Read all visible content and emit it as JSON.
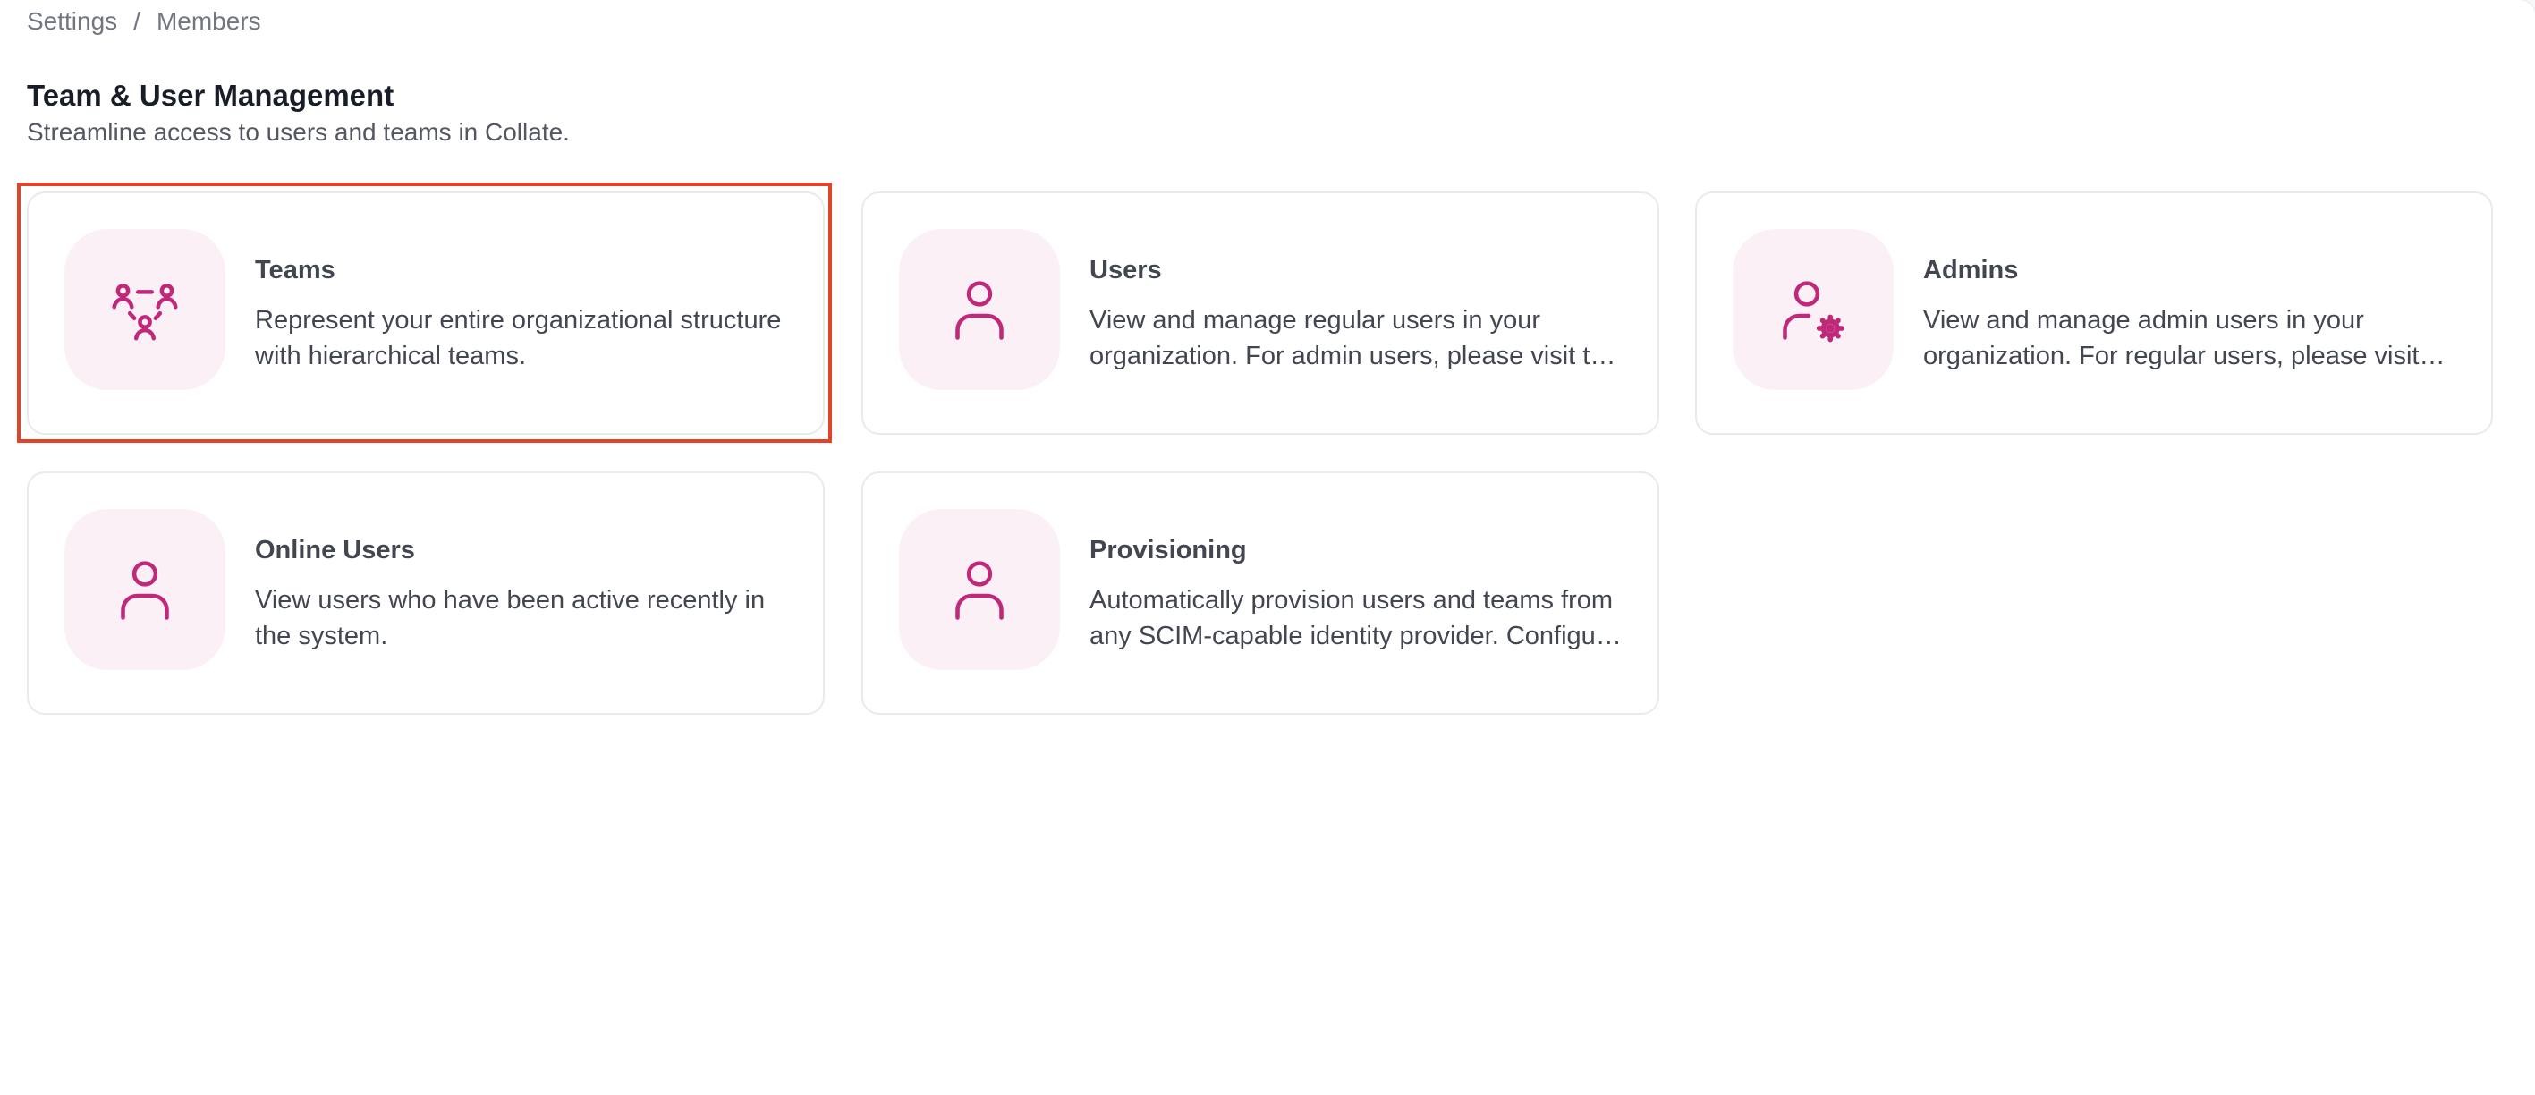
{
  "breadcrumb": {
    "items": [
      "Settings",
      "Members"
    ],
    "separator": "/"
  },
  "header": {
    "title": "Team & User Management",
    "subtitle": "Streamline access to users and teams in Collate."
  },
  "cards": [
    {
      "title": "Teams",
      "description": "Represent your entire organizational structure with hierarchical teams.",
      "icon": "teams-icon"
    },
    {
      "title": "Users",
      "description": "View and manage regular users in your organization. For admin users, please visit the Admins page.",
      "icon": "user-icon"
    },
    {
      "title": "Admins",
      "description": "View and manage admin users in your organization. For regular users, please visit the Users page.",
      "icon": "admin-user-icon"
    },
    {
      "title": "Online Users",
      "description": "View users who have been active recently in the system.",
      "icon": "user-icon"
    },
    {
      "title": "Provisioning",
      "description": "Automatically provision users and teams from any SCIM-capable identity provider. Configure your identity provider to sync users.",
      "icon": "user-icon"
    }
  ],
  "colors": {
    "accent": "#c0287a",
    "icon_bg": "#fcf0f7",
    "highlight": "#e2432a"
  }
}
